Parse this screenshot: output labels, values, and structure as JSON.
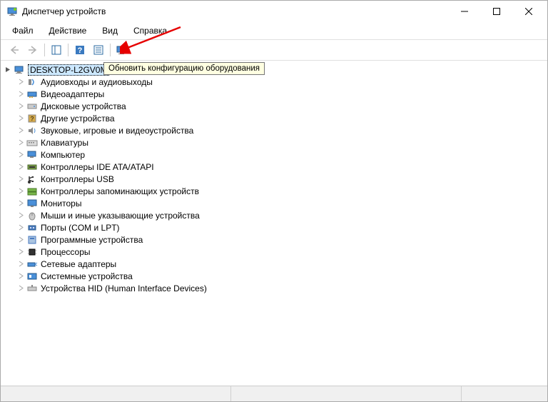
{
  "title": "Диспетчер устройств",
  "menus": {
    "file": "Файл",
    "action": "Действие",
    "view": "Вид",
    "help": "Справка"
  },
  "tooltip": "Обновить конфигурацию оборудования",
  "root_node": "DESKTOP-L2GV0M",
  "categories": [
    {
      "icon": "audio-io",
      "label": "Аудиовходы и аудиовыходы"
    },
    {
      "icon": "display-adapter",
      "label": "Видеоадаптеры"
    },
    {
      "icon": "disk-drive",
      "label": "Дисковые устройства"
    },
    {
      "icon": "other-device",
      "label": "Другие устройства"
    },
    {
      "icon": "sound-game",
      "label": "Звуковые, игровые и видеоустройства"
    },
    {
      "icon": "keyboard",
      "label": "Клавиатуры"
    },
    {
      "icon": "computer",
      "label": "Компьютер"
    },
    {
      "icon": "ide-controller",
      "label": "Контроллеры IDE ATA/ATAPI"
    },
    {
      "icon": "usb-controller",
      "label": "Контроллеры USB"
    },
    {
      "icon": "storage-controller",
      "label": "Контроллеры запоминающих устройств"
    },
    {
      "icon": "monitor",
      "label": "Мониторы"
    },
    {
      "icon": "mouse",
      "label": "Мыши и иные указывающие устройства"
    },
    {
      "icon": "port",
      "label": "Порты (COM и LPT)"
    },
    {
      "icon": "software-device",
      "label": "Программные устройства"
    },
    {
      "icon": "processor",
      "label": "Процессоры"
    },
    {
      "icon": "network-adapter",
      "label": "Сетевые адаптеры"
    },
    {
      "icon": "system-device",
      "label": "Системные устройства"
    },
    {
      "icon": "hid-device",
      "label": "Устройства HID (Human Interface Devices)"
    }
  ]
}
